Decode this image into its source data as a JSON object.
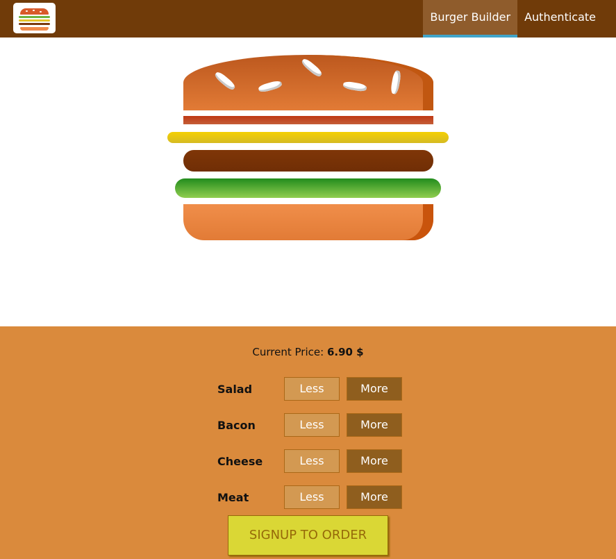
{
  "toolbar": {
    "logo": "burger-logo-icon",
    "nav": [
      {
        "label": "Burger Builder",
        "active": true
      },
      {
        "label": "Authenticate",
        "active": false
      }
    ]
  },
  "burger": {
    "layers": [
      "bread-top",
      "bacon",
      "cheese",
      "meat",
      "salad",
      "bread-bottom"
    ]
  },
  "controls": {
    "price_label": "Current Price:",
    "price_value": "6.90 $",
    "ingredients": [
      {
        "label": "Salad",
        "less": "Less",
        "more": "More"
      },
      {
        "label": "Bacon",
        "less": "Less",
        "more": "More"
      },
      {
        "label": "Cheese",
        "less": "Less",
        "more": "More"
      },
      {
        "label": "Meat",
        "less": "Less",
        "more": "More"
      }
    ],
    "order_button": "SIGNUP TO ORDER"
  },
  "colors": {
    "toolbar_bg": "#703B09",
    "active_tab_bg": "#8F5C2C",
    "active_tab_border": "#40A4C8",
    "controls_bg": "#DA8A3C",
    "order_button_bg": "#DAD735",
    "order_button_text": "#966909"
  }
}
